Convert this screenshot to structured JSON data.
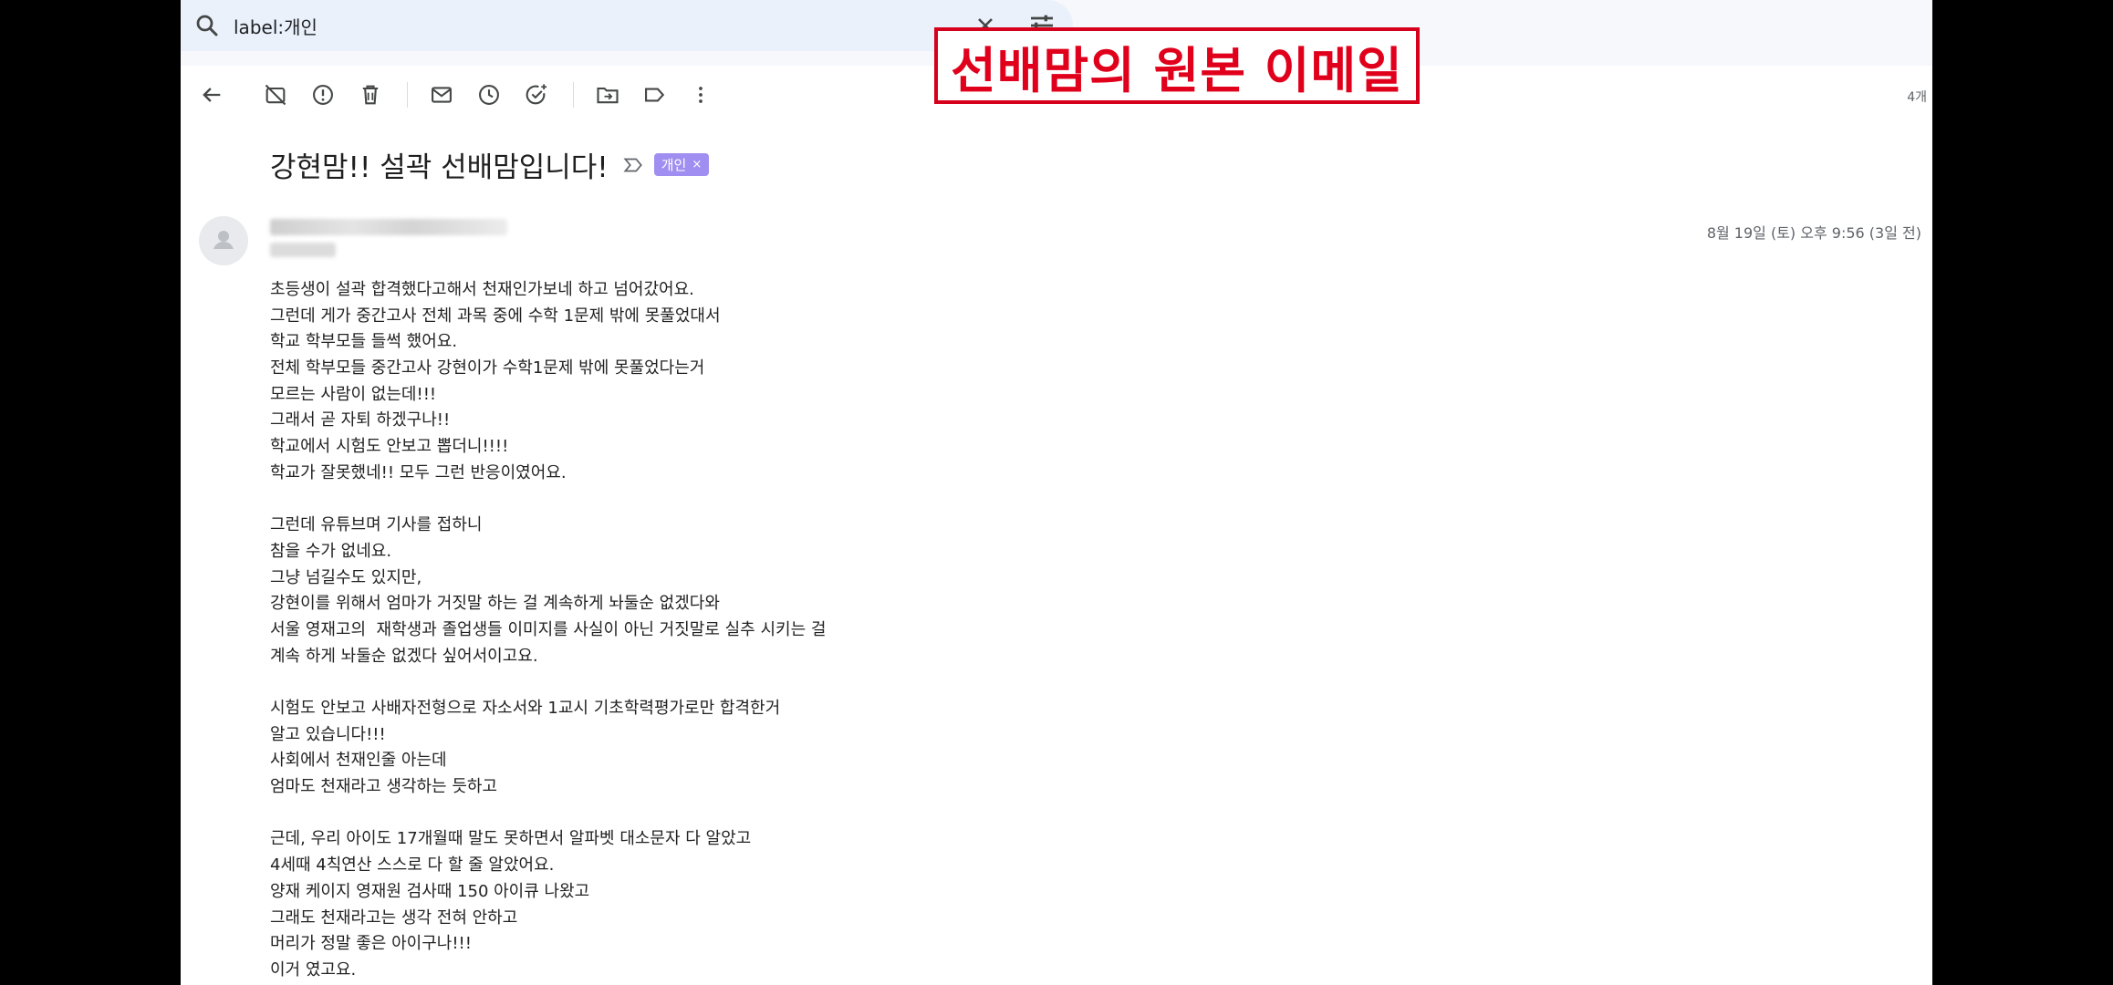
{
  "search": {
    "query": "label:개인"
  },
  "toolbar": {
    "icons": [
      "back-arrow-icon",
      "archive-off-icon",
      "report-spam-icon",
      "delete-icon",
      "mark-unread-icon",
      "snooze-icon",
      "add-task-icon",
      "move-to-icon",
      "label-icon",
      "more-vert-icon"
    ],
    "count": "4개"
  },
  "annotation": {
    "text": "선배맘의 원본 이메일",
    "color": "#e0001b"
  },
  "email": {
    "subject": "강현맘!! 설곽 선배맘입니다!",
    "label": "개인",
    "label_color": "#a08ff0",
    "date": "8월 19일 (토) 오후 9:56 (3일 전)",
    "paragraphs": [
      [
        "초등생이 설곽 합격했다고해서 천재인가보네 하고 넘어갔어요.",
        "그런데 게가 중간고사 전체 과목 중에 수학 1문제 밖에 못풀었대서",
        "학교 학부모들 들썩 했어요.",
        "전체 학부모들 중간고사 강현이가 수학1문제 밖에 못풀었다는거",
        "모르는 사람이 없는데!!!",
        "그래서 곧 자퇴 하겠구나!!",
        "학교에서 시험도 안보고 뽑더니!!!!",
        "학교가 잘못했네!! 모두 그런 반응이였어요."
      ],
      [
        "그런데 유튜브며 기사를 접하니",
        "참을 수가 없네요.",
        "그냥 넘길수도 있지만,",
        "강현이를 위해서 엄마가 거짓말 하는 걸 계속하게 놔둘순 없겠다와",
        "서울 영재고의  재학생과 졸업생들 이미지를 사실이 아닌 거짓말로 실추 시키는 걸",
        "계속 하게 놔둘순 없겠다 싶어서이고요."
      ],
      [
        "시험도 안보고 사배자전형으로 자소서와 1교시 기초학력평가로만 합격한거",
        "알고 있습니다!!!",
        "사회에서 천재인줄 아는데",
        "엄마도 천재라고 생각하는 듯하고"
      ],
      [
        "근데, 우리 아이도 17개월때 말도 못하면서 알파벳 대소문자 다 알았고",
        "4세때 4칙연산 스스로 다 할 줄 알았어요.",
        "양재 케이지 영재원 검사때 150 아이큐 나왔고",
        "그래도 천재라고는 생각 전혀 안하고",
        "머리가 정말 좋은 아이구나!!!",
        "이거 였고요."
      ]
    ]
  }
}
